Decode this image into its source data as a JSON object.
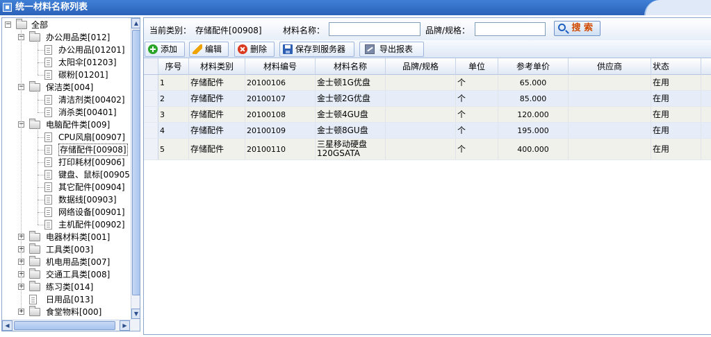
{
  "window": {
    "title": "统一材料名称列表"
  },
  "tree": {
    "root": "全部",
    "nodes": [
      {
        "label": "办公用品类[012]",
        "children": [
          "办公用品[01201]",
          "太阳伞[01203]",
          "碳粉[01201]"
        ]
      },
      {
        "label": "保洁类[004]",
        "children": [
          "清洁剂类[00402]",
          "消杀类[00401]"
        ]
      },
      {
        "label": "电脑配件类[009]",
        "children": [
          "CPU风扇[00907]",
          "存储配件[00908]",
          "打印耗材[00906]",
          "键盘、鼠标[00905]",
          "其它配件[00904]",
          "数据线[00903]",
          "网络设备[00901]",
          "主机配件[00902]"
        ]
      },
      {
        "label": "电器材料类[001]"
      },
      {
        "label": "工具类[003]"
      },
      {
        "label": "机电用品类[007]"
      },
      {
        "label": "交通工具类[008]"
      },
      {
        "label": "练习类[014]"
      },
      {
        "label": "日用品[013]"
      },
      {
        "label": "食堂物料[000]"
      }
    ],
    "selected": "存储配件[00908]"
  },
  "search": {
    "current_category_label": "当前类别：",
    "current_category_value": "存储配件[00908]",
    "name_label": "材料名称：",
    "name_value": "",
    "brand_label": "品牌/规格：",
    "brand_value": "",
    "button_label": "搜 索"
  },
  "toolbar": {
    "add": "添加",
    "edit": "编辑",
    "delete": "删除",
    "save": "保存到服务器",
    "export": "导出报表"
  },
  "table": {
    "headers": [
      "序号",
      "材料类别",
      "材料编号",
      "材料名称",
      "品牌/规格",
      "单位",
      "参考单价",
      "供应商",
      "状态"
    ],
    "rows": [
      [
        "1",
        "存储配件",
        "20100106",
        "金士顿1G优盘",
        "",
        "个",
        "65.000",
        "",
        "在用"
      ],
      [
        "2",
        "存储配件",
        "20100107",
        "金士顿2G优盘",
        "",
        "个",
        "85.000",
        "",
        "在用"
      ],
      [
        "3",
        "存储配件",
        "20100108",
        "金士顿4GU盘",
        "",
        "个",
        "120.000",
        "",
        "在用"
      ],
      [
        "4",
        "存储配件",
        "20100109",
        "金士顿8GU盘",
        "",
        "个",
        "195.000",
        "",
        "在用"
      ],
      [
        "5",
        "存储配件",
        "20100110",
        "三星移动硬盘\n120GSATA",
        "",
        "个",
        "400.000",
        "",
        "在用"
      ]
    ]
  },
  "colors": {
    "title_bar": "#2a62b8",
    "row_odd": "#f1f1ec",
    "row_even": "#e6edf8"
  }
}
